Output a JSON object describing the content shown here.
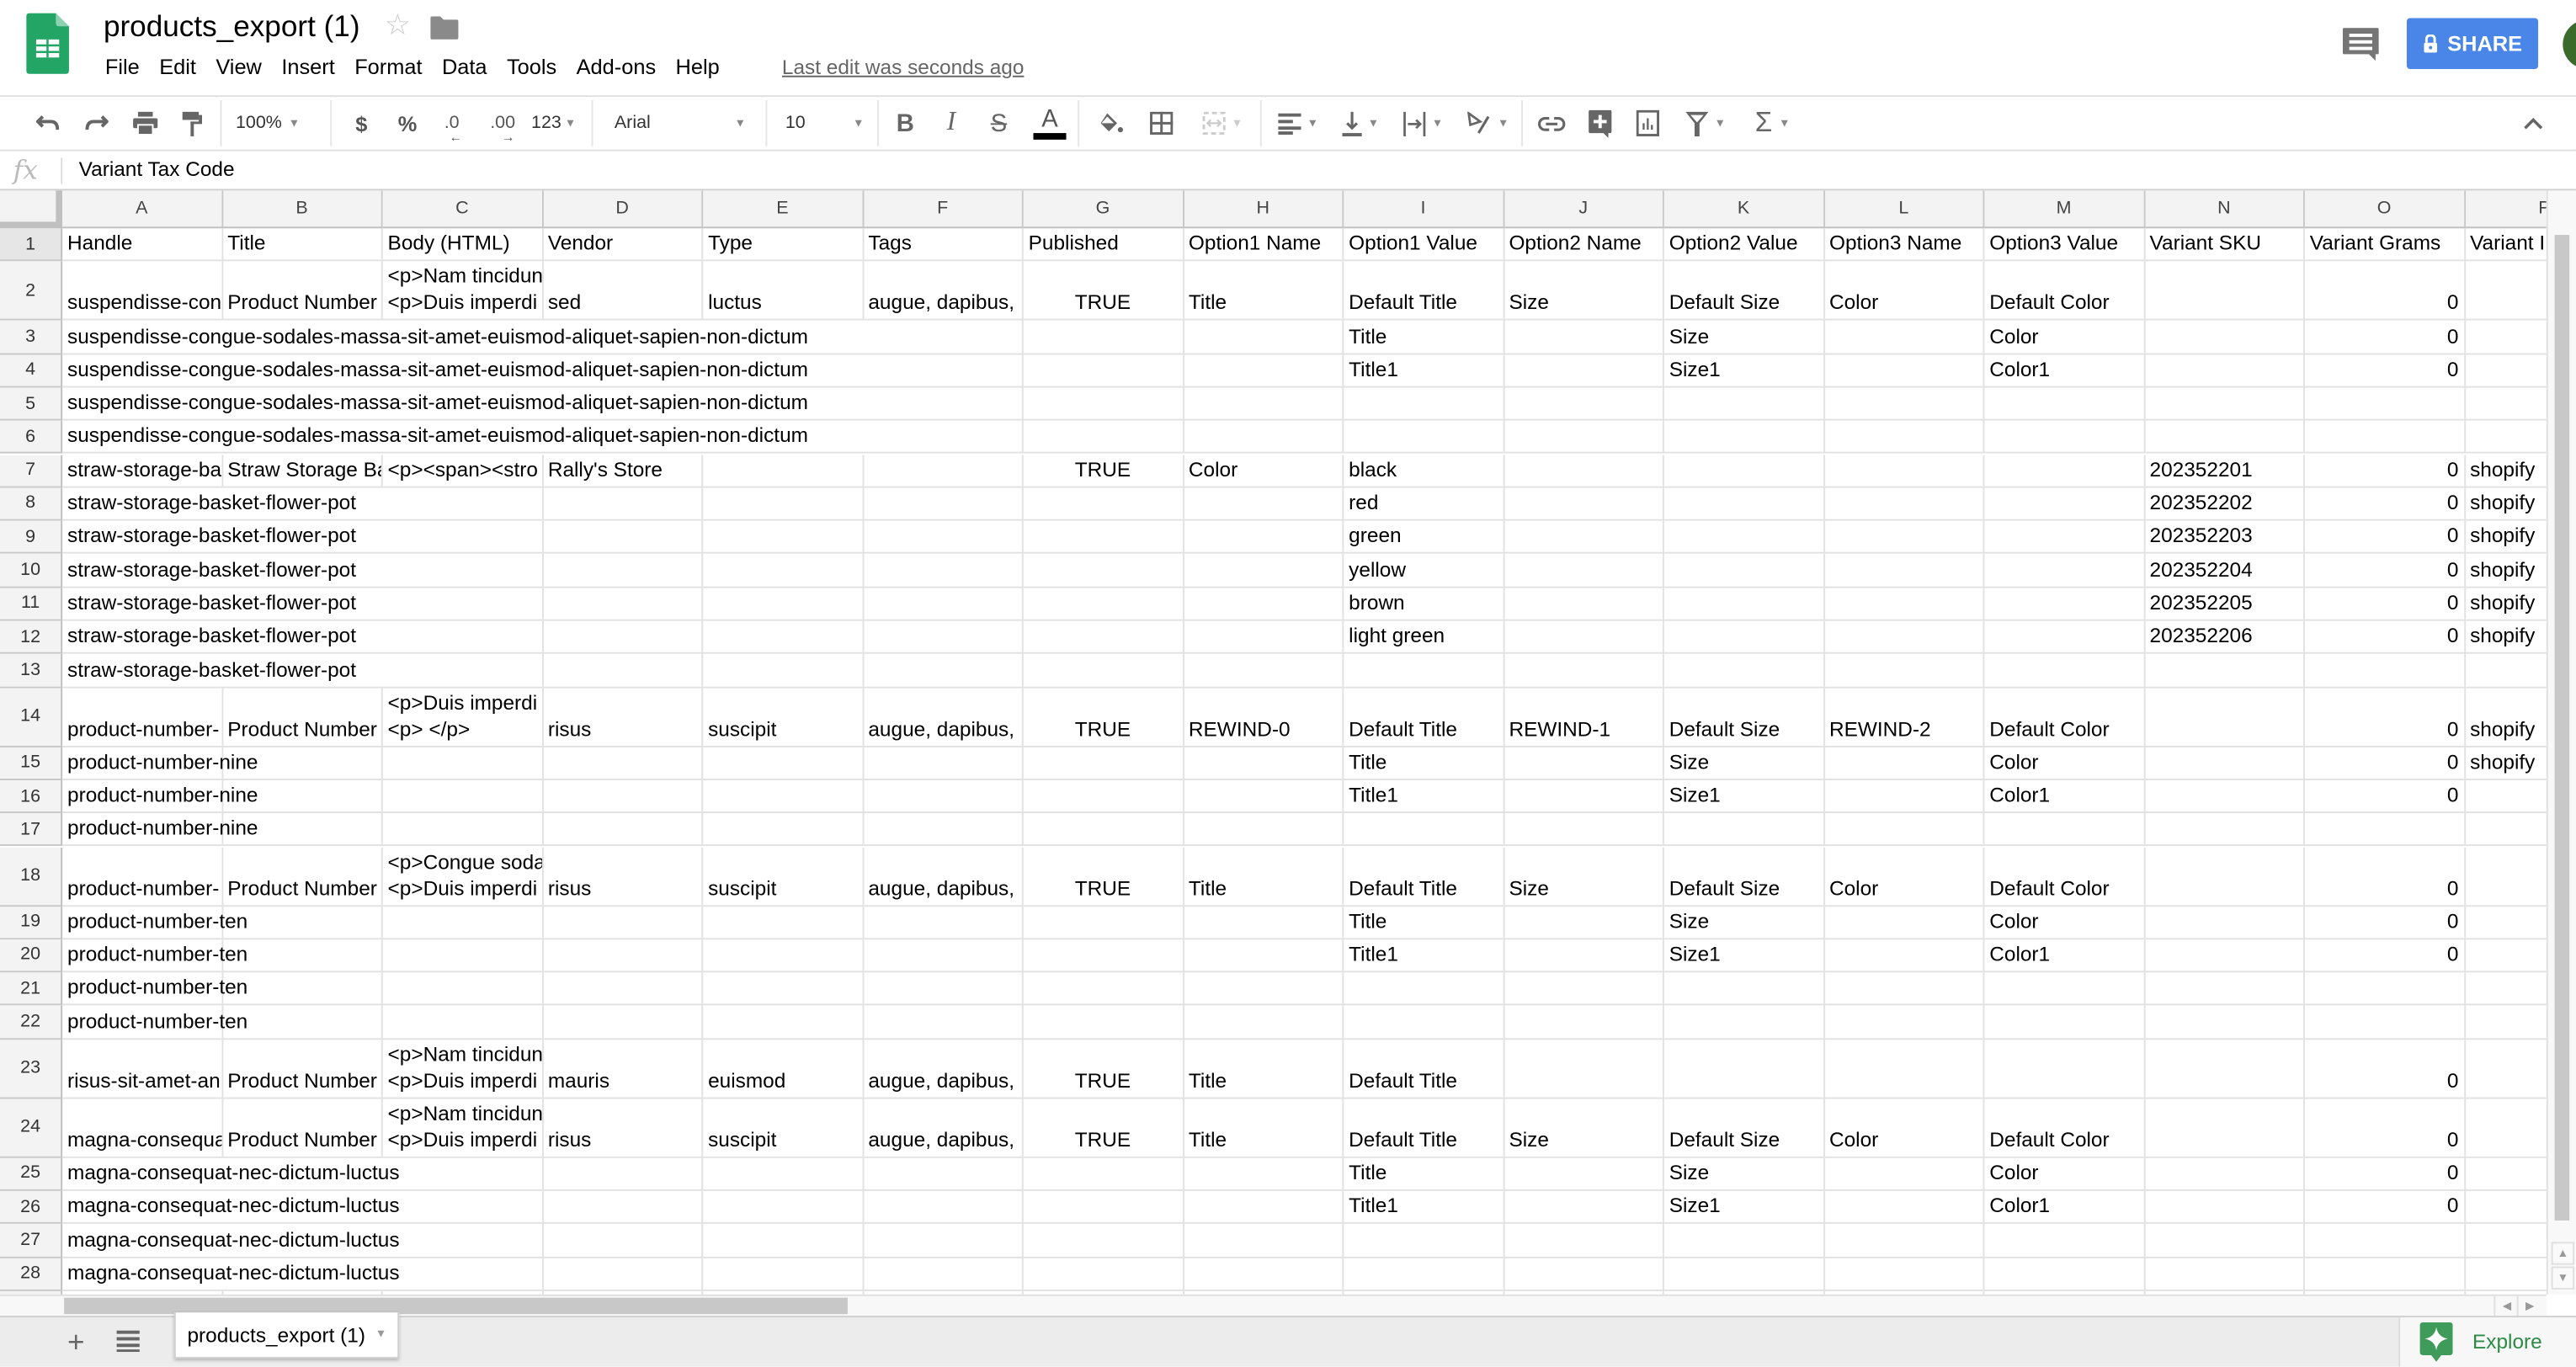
{
  "app": {
    "doc_title": "products_export (1)",
    "menu": [
      "File",
      "Edit",
      "View",
      "Insert",
      "Format",
      "Data",
      "Tools",
      "Add-ons",
      "Help"
    ],
    "last_edit": "Last edit was seconds ago",
    "share_label": "SHARE",
    "brand_color": "#4a86e8"
  },
  "toolbar": {
    "zoom": "100%",
    "currency": "$",
    "percent": "%",
    "dec_decrease": ".0",
    "dec_increase": ".00",
    "more_formats": "123",
    "font": "Arial",
    "font_size": "10"
  },
  "formula_bar": {
    "fx_label": "fx",
    "value": "Variant Tax Code"
  },
  "grid": {
    "columns": [
      "A",
      "B",
      "C",
      "D",
      "E",
      "F",
      "G",
      "H",
      "I",
      "J",
      "K",
      "L",
      "M",
      "N",
      "O",
      "P"
    ],
    "rows": [
      {
        "n": "1",
        "tall": false,
        "cells": {
          "A": "Handle",
          "B": "Title",
          "C": "Body (HTML)",
          "D": "Vendor",
          "E": "Type",
          "F": "Tags",
          "G": "Published",
          "H": "Option1 Name",
          "I": "Option1 Value",
          "J": "Option2 Name",
          "K": "Option2 Value",
          "L": "Option3 Name",
          "M": "Option3 Value",
          "N": "Variant SKU",
          "O": "Variant Grams",
          "P": "Variant I"
        }
      },
      {
        "n": "2",
        "tall": true,
        "cells": {
          "A": "suspendisse-con",
          "B": "Product Number",
          "C": [
            "<p>Nam tincidun",
            "<p>Duis imperdi"
          ],
          "D": "sed",
          "E": "luctus",
          "F": "augue, dapibus,",
          "G": "TRUE",
          "H": "Title",
          "I": "Default Title",
          "J": "Size",
          "K": "Default Size",
          "L": "Color",
          "M": "Default Color",
          "O": "0"
        }
      },
      {
        "n": "3",
        "tall": false,
        "cells": {
          "A": "suspendisse-congue-sodales-massa-sit-amet-euismod-aliquet-sapien-non-dictum",
          "I": "Title",
          "K": "Size",
          "M": "Color",
          "O": "0"
        }
      },
      {
        "n": "4",
        "tall": false,
        "cells": {
          "A": "suspendisse-congue-sodales-massa-sit-amet-euismod-aliquet-sapien-non-dictum",
          "I": "Title1",
          "K": "Size1",
          "M": "Color1",
          "O": "0"
        }
      },
      {
        "n": "5",
        "tall": false,
        "cells": {
          "A": "suspendisse-congue-sodales-massa-sit-amet-euismod-aliquet-sapien-non-dictum"
        }
      },
      {
        "n": "6",
        "tall": false,
        "cells": {
          "A": "suspendisse-congue-sodales-massa-sit-amet-euismod-aliquet-sapien-non-dictum"
        }
      },
      {
        "n": "7",
        "tall": false,
        "cells": {
          "A": "straw-storage-ba",
          "B": "Straw Storage Ba",
          "C": "<p><span><stro",
          "D": "Rally's Store",
          "G": "TRUE",
          "H": "Color",
          "I": "black",
          "N": "202352201",
          "O": "0",
          "P": "shopify"
        }
      },
      {
        "n": "8",
        "tall": false,
        "cells": {
          "A": "straw-storage-basket-flower-pot",
          "I": "red",
          "N": "202352202",
          "O": "0",
          "P": "shopify"
        }
      },
      {
        "n": "9",
        "tall": false,
        "cells": {
          "A": "straw-storage-basket-flower-pot",
          "I": "green",
          "N": "202352203",
          "O": "0",
          "P": "shopify"
        }
      },
      {
        "n": "10",
        "tall": false,
        "cells": {
          "A": "straw-storage-basket-flower-pot",
          "I": "yellow",
          "N": "202352204",
          "O": "0",
          "P": "shopify"
        }
      },
      {
        "n": "11",
        "tall": false,
        "cells": {
          "A": "straw-storage-basket-flower-pot",
          "I": "brown",
          "N": "202352205",
          "O": "0",
          "P": "shopify"
        }
      },
      {
        "n": "12",
        "tall": false,
        "cells": {
          "A": "straw-storage-basket-flower-pot",
          "I": "light green",
          "N": "202352206",
          "O": "0",
          "P": "shopify"
        }
      },
      {
        "n": "13",
        "tall": false,
        "cells": {
          "A": "straw-storage-basket-flower-pot"
        }
      },
      {
        "n": "14",
        "tall": true,
        "cells": {
          "A": "product-number-",
          "B": "Product Number",
          "C": [
            "<p>Duis imperdi",
            "<p> </p>"
          ],
          "D": "risus",
          "E": "suscipit",
          "F": "augue, dapibus,",
          "G": "TRUE",
          "H": "REWIND-0",
          "I": "Default Title",
          "J": "REWIND-1",
          "K": "Default Size",
          "L": "REWIND-2",
          "M": "Default Color",
          "O": "0",
          "P": "shopify"
        }
      },
      {
        "n": "15",
        "tall": false,
        "cells": {
          "A": "product-number-nine",
          "I": "Title",
          "K": "Size",
          "M": "Color",
          "O": "0",
          "P": "shopify"
        }
      },
      {
        "n": "16",
        "tall": false,
        "cells": {
          "A": "product-number-nine",
          "I": "Title1",
          "K": "Size1",
          "M": "Color1",
          "O": "0"
        }
      },
      {
        "n": "17",
        "tall": false,
        "cells": {
          "A": "product-number-nine"
        }
      },
      {
        "n": "18",
        "tall": true,
        "cells": {
          "A": "product-number-",
          "B": "Product Number",
          "C": [
            "<p>Congue soda",
            "<p>Duis imperdi"
          ],
          "D": "risus",
          "E": "suscipit",
          "F": "augue, dapibus,",
          "G": "TRUE",
          "H": "Title",
          "I": "Default Title",
          "J": "Size",
          "K": "Default Size",
          "L": "Color",
          "M": "Default Color",
          "O": "0"
        }
      },
      {
        "n": "19",
        "tall": false,
        "cells": {
          "A": "product-number-ten",
          "I": "Title",
          "K": "Size",
          "M": "Color",
          "O": "0"
        }
      },
      {
        "n": "20",
        "tall": false,
        "cells": {
          "A": "product-number-ten",
          "I": "Title1",
          "K": "Size1",
          "M": "Color1",
          "O": "0"
        }
      },
      {
        "n": "21",
        "tall": false,
        "cells": {
          "A": "product-number-ten"
        }
      },
      {
        "n": "22",
        "tall": false,
        "cells": {
          "A": "product-number-ten"
        }
      },
      {
        "n": "23",
        "tall": true,
        "cells": {
          "A": "risus-sit-amet-an",
          "B": "Product Number",
          "C": [
            "<p>Nam tincidun",
            "<p>Duis imperdi"
          ],
          "D": "mauris",
          "E": "euismod",
          "F": "augue, dapibus,",
          "G": "TRUE",
          "H": "Title",
          "I": "Default Title",
          "O": "0"
        }
      },
      {
        "n": "24",
        "tall": true,
        "cells": {
          "A": "magna-consequa",
          "B": "Product Number",
          "C": [
            "<p>Nam tincidun",
            "<p>Duis imperdi"
          ],
          "D": "risus",
          "E": "suscipit",
          "F": "augue, dapibus,",
          "G": "TRUE",
          "H": "Title",
          "I": "Default Title",
          "J": "Size",
          "K": "Default Size",
          "L": "Color",
          "M": "Default Color",
          "O": "0"
        }
      },
      {
        "n": "25",
        "tall": false,
        "cells": {
          "A": "magna-consequat-nec-dictum-luctus",
          "I": "Title",
          "K": "Size",
          "M": "Color",
          "O": "0"
        }
      },
      {
        "n": "26",
        "tall": false,
        "cells": {
          "A": "magna-consequat-nec-dictum-luctus",
          "I": "Title1",
          "K": "Size1",
          "M": "Color1",
          "O": "0"
        }
      },
      {
        "n": "27",
        "tall": false,
        "cells": {
          "A": "magna-consequat-nec-dictum-luctus"
        }
      },
      {
        "n": "28",
        "tall": false,
        "cells": {
          "A": "magna-consequat-nec-dictum-luctus"
        }
      },
      {
        "n": "",
        "tall": false,
        "cells": {}
      }
    ]
  },
  "sheets": {
    "tabs": [
      "products_export (1)"
    ],
    "explore_label": "Explore"
  }
}
